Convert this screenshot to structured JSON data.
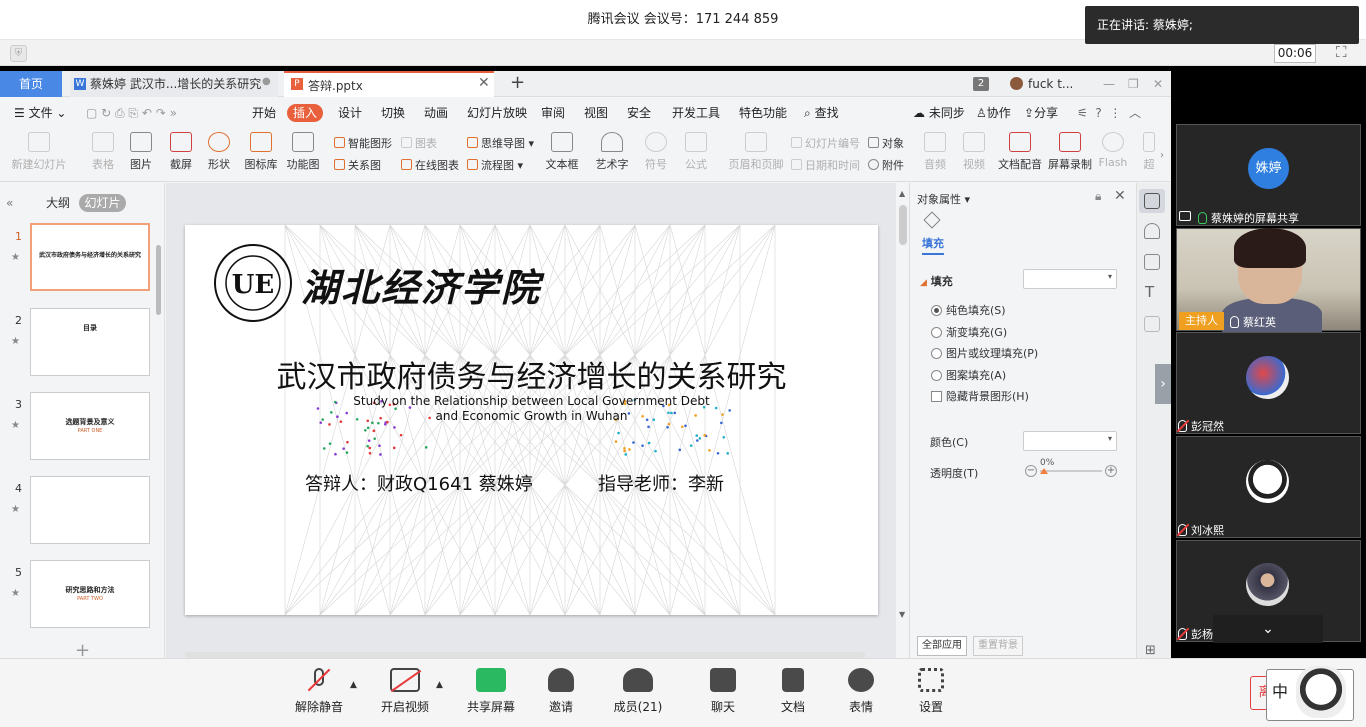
{
  "meeting": {
    "title": "腾讯会议 会议号：171 244 859",
    "speaking": "正在讲话: 蔡姝婷;",
    "timer": "00:06"
  },
  "wps": {
    "tabs": {
      "home": "首页",
      "doc": "蔡姝婷 武汉市...增长的关系研究",
      "ppt": "答辩.pptx",
      "count_badge": "2",
      "user": "fuck t..."
    },
    "menu": {
      "file": "文件",
      "items": [
        "开始",
        "插入",
        "设计",
        "切换",
        "动画",
        "幻灯片放映",
        "审阅",
        "视图",
        "安全",
        "开发工具",
        "特色功能"
      ],
      "search": "查找",
      "sync": "未同步",
      "collab": "协作",
      "share": "分享"
    },
    "ribbon": {
      "new_slide": "新建幻灯片",
      "table": "表格",
      "picture": "图片",
      "screenshot": "截屏",
      "shape": "形状",
      "icon_lib": "图标库",
      "func_chart": "功能图",
      "smart_shape": "智能图形",
      "chart": "图表",
      "mind_map": "思维导图",
      "relation": "关系图",
      "online_chart": "在线图表",
      "flow": "流程图",
      "textbox": "文本框",
      "art_text": "艺术字",
      "symbol": "符号",
      "formula": "公式",
      "header_footer": "页眉和页脚",
      "slide_number": "幻灯片编号",
      "object": "对象",
      "datetime": "日期和时间",
      "attachment": "附件",
      "audio": "音频",
      "video": "视频",
      "voiceover": "文档配音",
      "screen_record": "屏幕录制",
      "flash": "Flash",
      "more": "超"
    },
    "left_pane": {
      "outline_tab": "大纲",
      "slides_tab": "幻灯片",
      "slides": [
        {
          "num": "1",
          "title": "武汉市政府债务与经济增长的关系研究",
          "sub": ""
        },
        {
          "num": "2",
          "title": "目录",
          "sub": ""
        },
        {
          "num": "3",
          "title": "选题背景及意义",
          "sub": "PART ONE"
        },
        {
          "num": "4",
          "title": "",
          "sub": ""
        },
        {
          "num": "5",
          "title": "研究思路和方法",
          "sub": "PART TWO"
        }
      ]
    },
    "slide": {
      "university_name": "湖北经济学院",
      "logo_text": "HUBEI UNIVERSITY OF ECONOMICS",
      "title": "武汉市政府债务与经济增长的关系研究",
      "subtitle_line1": "Study on the Relationship between Local Government Debt",
      "subtitle_line2": "and Economic Growth in Wuhan",
      "presenter": "答辩人：财政Q1641  蔡姝婷",
      "advisor": "指导老师：李新"
    },
    "props": {
      "title": "对象属性",
      "tab_fill": "填充",
      "fill_label": "填充",
      "options": [
        "纯色填充(S)",
        "渐变填充(G)",
        "图片或纹理填充(P)",
        "图案填充(A)"
      ],
      "selected_option": "纯色填充(S)",
      "hide_bg": "隐藏背景图形(H)",
      "color_label": "颜色(C)",
      "transparency_label": "透明度(T)",
      "transparency_value": "0%",
      "apply_all": "全部应用",
      "reset_bg": "重置背景"
    }
  },
  "participants": {
    "sharer_avatar_text": "姝婷",
    "sharer_label": "蔡姝婷的屏幕共享",
    "host_badge": "主持人",
    "host_name": "蔡红英",
    "p3": "彭冠然",
    "p4": "刘冰熙",
    "p5": "彭杨"
  },
  "toolbar": {
    "unmute": "解除静音",
    "video": "开启视频",
    "share": "共享屏幕",
    "invite": "邀请",
    "members": "成员(21)",
    "chat": "聊天",
    "docs": "文档",
    "reactions": "表情",
    "settings": "设置",
    "leave": "离",
    "ime_char": "中"
  },
  "colors": {
    "accent_orange": "#e8603c",
    "tab_blue": "#4a88e6",
    "share_green": "#2ab860",
    "avatar_blue": "#2f7fe0",
    "host_badge": "#f0a020"
  }
}
